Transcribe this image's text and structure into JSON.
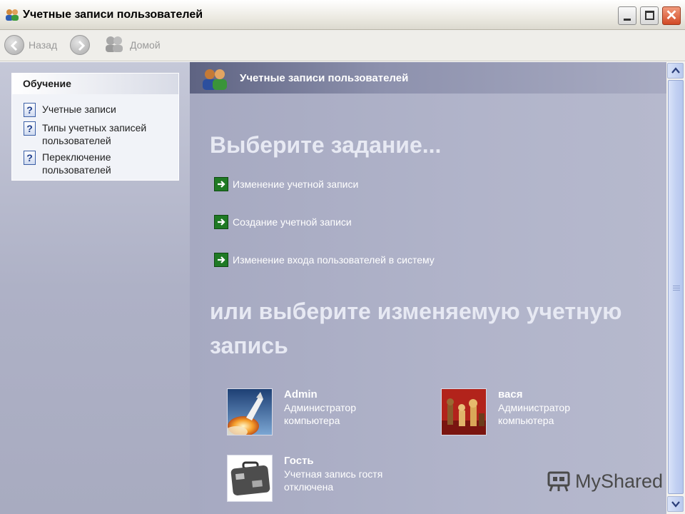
{
  "window": {
    "title": "Учетные записи пользователей"
  },
  "toolbar": {
    "back_label": "Назад",
    "home_label": "Домой"
  },
  "sidebar": {
    "header": "Обучение",
    "items": [
      {
        "label": "Учетные записи",
        "icon": "help-icon"
      },
      {
        "label": "Типы учетных записей пользователей",
        "icon": "help-icon"
      },
      {
        "label": "Переключение пользователей",
        "icon": "help-icon"
      }
    ]
  },
  "main": {
    "header_title": "Учетные записи пользователей",
    "tasks_heading": "Выберите задание...",
    "tasks": [
      {
        "label": "Изменение учетной записи",
        "icon": "green-arrow-icon"
      },
      {
        "label": "Создание учетной записи",
        "icon": "green-arrow-icon"
      },
      {
        "label": "Изменение входа пользователей в систему",
        "icon": "green-arrow-icon"
      }
    ],
    "accounts_heading": "или выберите изменяемую учетную запись",
    "accounts": [
      {
        "name": "Admin",
        "line1": "Администратор",
        "line2": "компьютера",
        "picture": "space-shuttle-picture"
      },
      {
        "name": "вася",
        "line1": "Администратор",
        "line2": "компьютера",
        "picture": "chess-picture"
      },
      {
        "name": "Гость",
        "line1": "Учетная запись гостя",
        "line2": "отключена",
        "picture": "suitcase-picture"
      }
    ]
  },
  "watermark": {
    "text": "MyShared"
  },
  "colors": {
    "title_bar": "#eceae2",
    "left_pane": "#b4b7cb",
    "right_pane": "#adb0c6",
    "header_band": "#5e6382",
    "task_arrow": "#1f7a24",
    "close_button": "#d24a25",
    "heading_text": "#e7e9f3"
  }
}
